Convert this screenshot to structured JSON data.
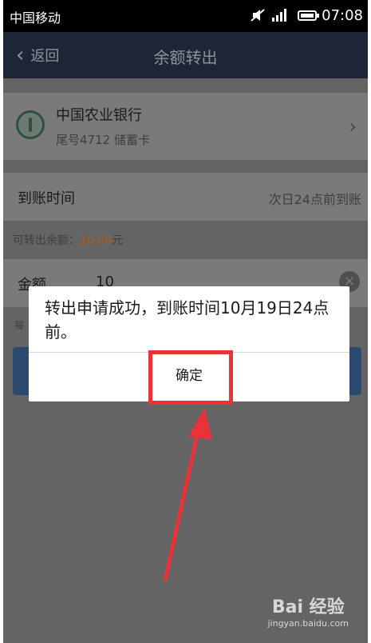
{
  "status_bar": {
    "carrier": "中国移动",
    "time": "07:08"
  },
  "nav": {
    "back_label": "返回",
    "title": "余额转出"
  },
  "bank": {
    "name": "中国农业银行",
    "detail": "尾号4712 储蓄卡"
  },
  "arrival": {
    "label": "到账时间",
    "value": "次日24点前到账"
  },
  "available": {
    "label": "可转出余额：",
    "amount": "10.00",
    "unit": "元"
  },
  "amount_field": {
    "label": "金额",
    "value": "10"
  },
  "note": "每",
  "dialog": {
    "message": "转出申请成功，到账时间10月19日24点前。",
    "ok_label": "确定"
  },
  "watermark": {
    "brand": "Bai 经验",
    "site": "jingyan.baidu.com"
  },
  "colors": {
    "highlight": "#e8333a",
    "nav_bg": "#1d2637",
    "amount_accent": "#b45a17"
  }
}
